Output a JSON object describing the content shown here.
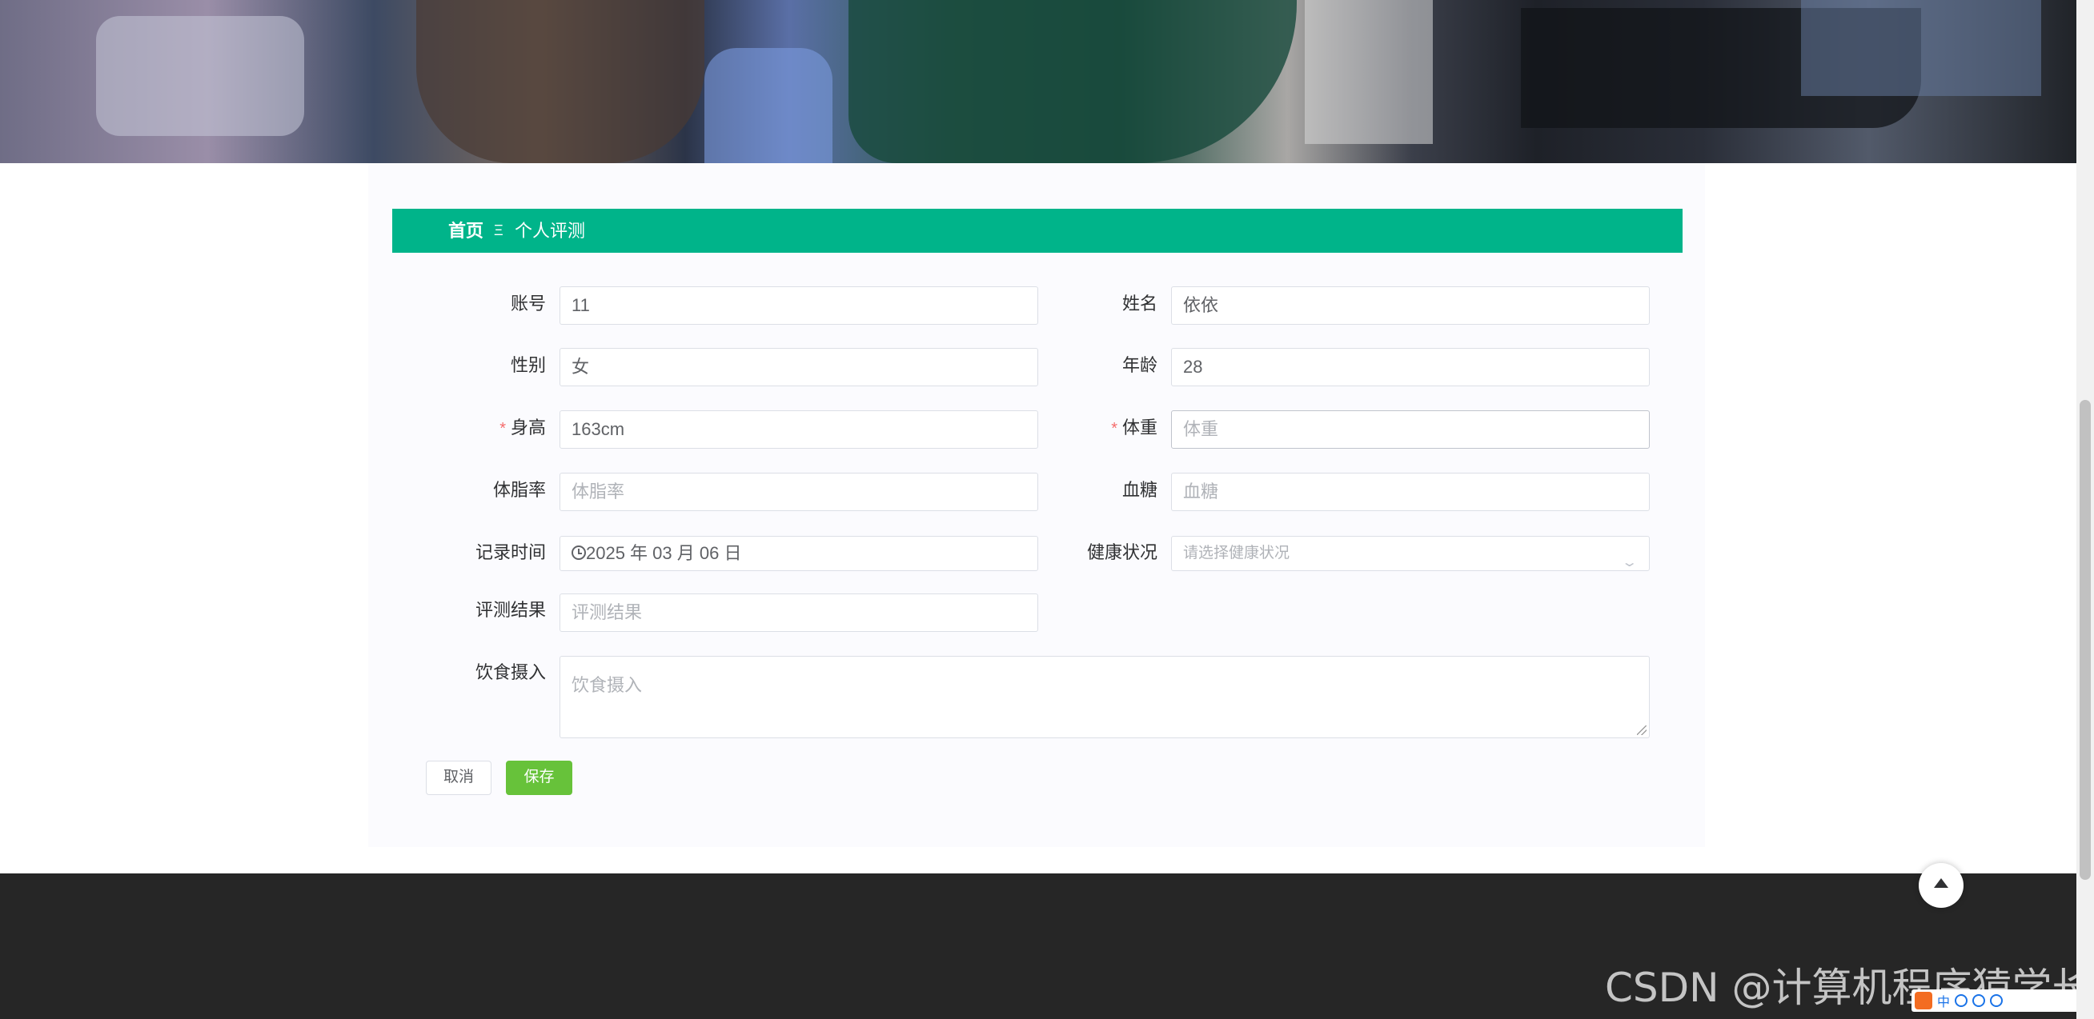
{
  "breadcrumb": {
    "home": "首页",
    "separator": "Ξ",
    "current": "个人评测"
  },
  "form": {
    "account": {
      "label": "账号",
      "value": "11"
    },
    "name": {
      "label": "姓名",
      "value": "依依"
    },
    "gender": {
      "label": "性别",
      "value": "女"
    },
    "age": {
      "label": "年龄",
      "value": "28"
    },
    "height": {
      "label": "身高",
      "required": "*",
      "value": "163cm"
    },
    "weight": {
      "label": "体重",
      "required": "*",
      "placeholder": "体重"
    },
    "bodyfat": {
      "label": "体脂率",
      "placeholder": "体脂率"
    },
    "bloodsugar": {
      "label": "血糖",
      "placeholder": "血糖"
    },
    "record_time": {
      "label": "记录时间",
      "value": "2025 年 03 月 06 日"
    },
    "health_status": {
      "label": "健康状况",
      "placeholder": "请选择健康状况"
    },
    "result": {
      "label": "评测结果",
      "placeholder": "评测结果"
    },
    "diet": {
      "label": "饮食摄入",
      "placeholder": "饮食摄入"
    }
  },
  "buttons": {
    "cancel": "取消",
    "save": "保存"
  },
  "watermark": "CSDN @计算机程序猿学长",
  "ime": {
    "mode": "中"
  },
  "colors": {
    "brand": "#00b48a",
    "save": "#67c23a",
    "required": "#f56c6c",
    "footer": "#262626"
  }
}
